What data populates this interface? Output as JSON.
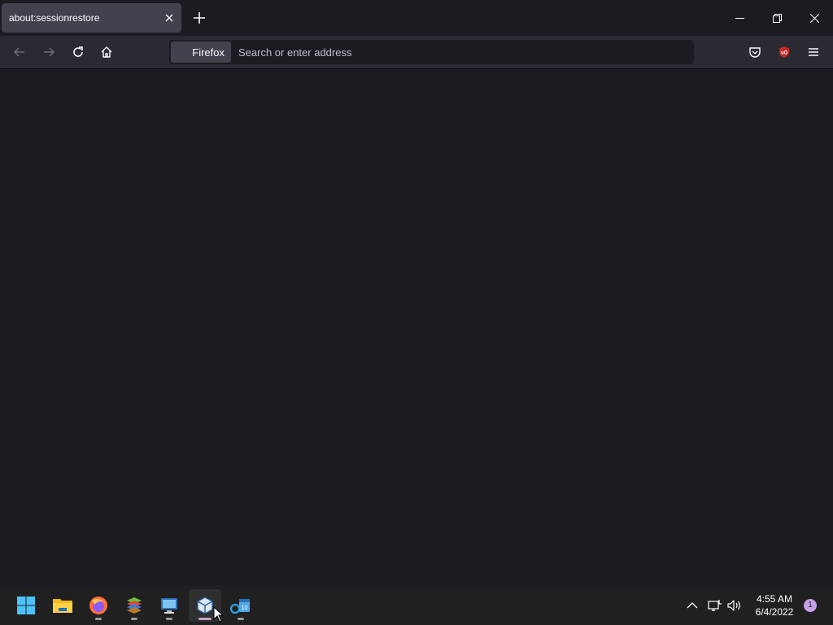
{
  "tab": {
    "title": "about:sessionrestore"
  },
  "urlbar": {
    "identity_label": "Firefox",
    "placeholder": "Search or enter address"
  },
  "taskbar": {
    "apps": [
      "start-icon",
      "file-explorer-icon",
      "firefox-icon",
      "winrar-icon",
      "remote-desktop-icon",
      "virtualbox-icon",
      "calendar-app-icon"
    ]
  },
  "tray": {
    "time": "4:55 AM",
    "date": "6/4/2022",
    "notification_count": "1"
  },
  "colors": {
    "background": "#1c1b22",
    "toolbar": "#2b2a33",
    "tab_selected": "#42414d",
    "taskbar": "#202020",
    "ublock": "#c62828"
  }
}
